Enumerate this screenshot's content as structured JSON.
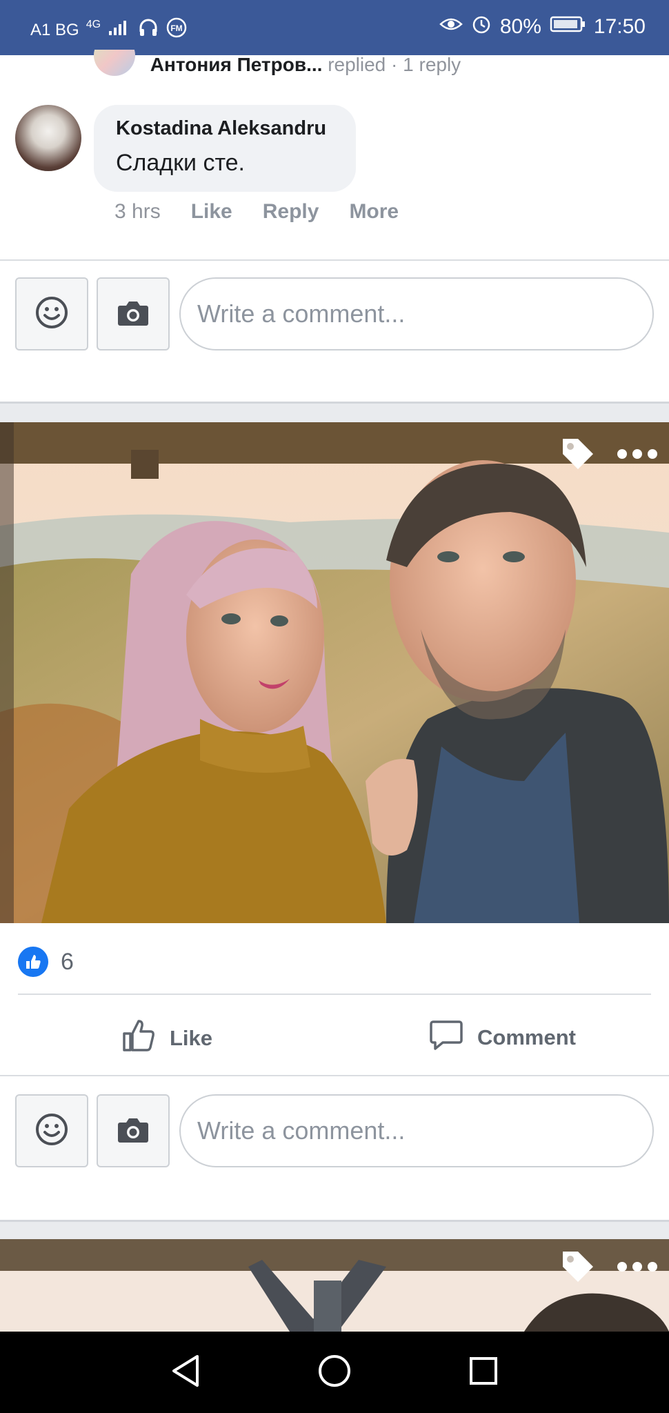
{
  "status_bar": {
    "carrier": "A1 BG",
    "network": "4G",
    "battery": "80%",
    "time": "17:50"
  },
  "thread": {
    "reply_name": "Антония Петров...",
    "reply_action": "replied",
    "reply_count": "1 reply"
  },
  "comment": {
    "author": "Kostadina Aleksandru",
    "text": "Сладки сте.",
    "time": "3 hrs",
    "like": "Like",
    "reply": "Reply",
    "more": "More"
  },
  "composer1": {
    "placeholder": "Write a comment..."
  },
  "post": {
    "like_count": "6",
    "like_label": "Like",
    "comment_label": "Comment"
  },
  "composer2": {
    "placeholder": "Write a comment..."
  },
  "icons": [
    "emoji-icon",
    "camera-icon",
    "tag-icon",
    "more-options-icon",
    "like-icon",
    "comment-icon",
    "back-nav-icon",
    "home-nav-icon",
    "recents-nav-icon"
  ],
  "colors": {
    "brand": "#3b5998",
    "like_blue": "#1877f2",
    "muted": "#90949c"
  }
}
